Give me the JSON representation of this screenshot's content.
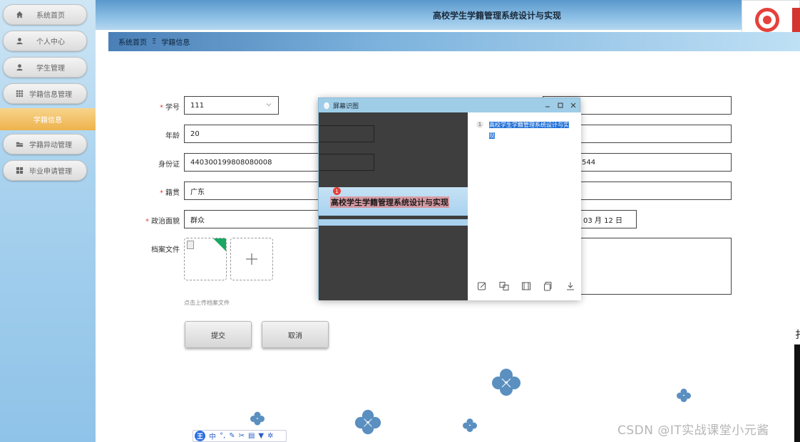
{
  "sidebar": {
    "items": [
      {
        "label": "系统首页",
        "icon": "home-icon"
      },
      {
        "label": "个人中心",
        "icon": "user-icon"
      },
      {
        "label": "学生管理",
        "icon": "user-icon"
      },
      {
        "label": "学籍信息管理",
        "icon": "grid-icon"
      },
      {
        "label": "学籍异动管理",
        "icon": "folder-icon"
      },
      {
        "label": "毕业申请管理",
        "icon": "grid-icon"
      }
    ],
    "active_sub": "学籍信息"
  },
  "header": {
    "title": "高校学生学籍管理系统设计与实现"
  },
  "breadcrumb": {
    "home": "系统首页",
    "separator": "Ξ",
    "current": "学籍信息"
  },
  "form": {
    "student_id": {
      "label": "学号",
      "value": "111"
    },
    "age": {
      "label": "年龄",
      "value": "20"
    },
    "id_card": {
      "label": "身份证",
      "value": "440300199808080008"
    },
    "hometown": {
      "label": "籍贯",
      "value": "广东"
    },
    "political": {
      "label": "政治面貌",
      "value": "群众"
    },
    "archive": {
      "label": "档案文件",
      "hint": "点击上传档案文件"
    },
    "right_partial_id": "544",
    "right_partial_date": "03 月 12 日"
  },
  "buttons": {
    "submit": "提交",
    "cancel": "取消"
  },
  "ocr_window": {
    "title": "屏幕识图",
    "captured_text": "高校学生学籍管理系统设计与实现",
    "marker": "1",
    "result_index": "1",
    "result_text": "高校学生学籍管理系统设计与实现"
  },
  "ime_bar": {
    "logo": "王",
    "mode": "中"
  },
  "watermark": "CSDN @IT实战课堂小元酱",
  "edge_char": "扌",
  "colors": {
    "sidebar_active": "#eeb24c",
    "header": "#8ec0e6",
    "required": "#e5413b",
    "ocr_highlight": "#1f6fd6"
  }
}
